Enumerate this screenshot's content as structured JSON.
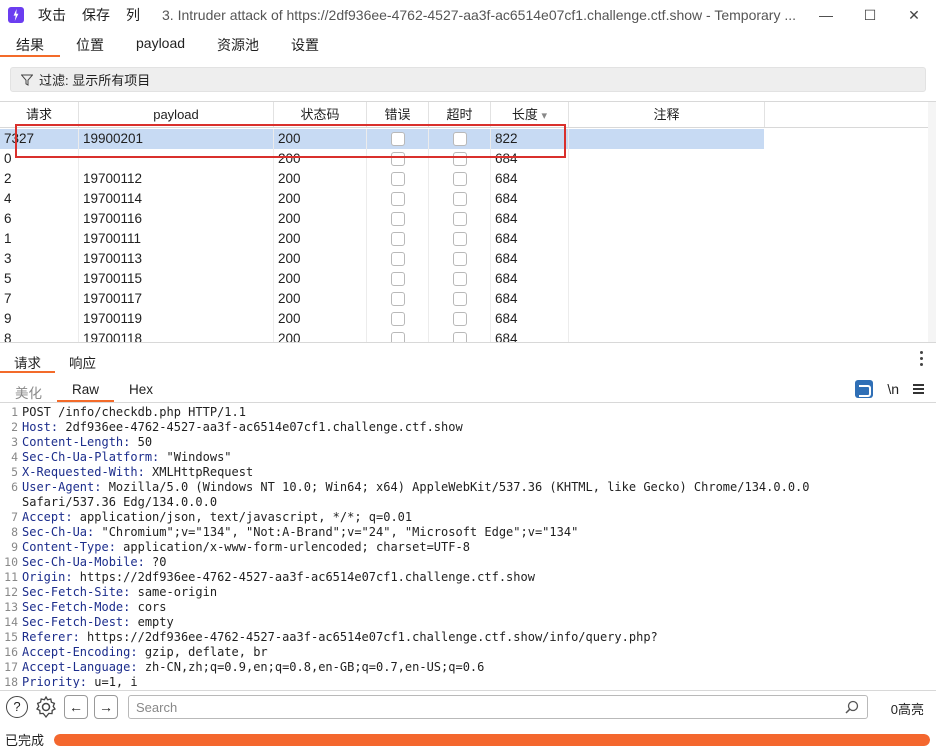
{
  "titlebar": {
    "menu": [
      "攻击",
      "保存",
      "列"
    ],
    "title": "3. Intruder attack of https://2df936ee-4762-4527-aa3f-ac6514e07cf1.challenge.ctf.show - Temporary ..."
  },
  "tabs": [
    "结果",
    "位置",
    "payload",
    "资源池",
    "设置"
  ],
  "filter": {
    "label": "过滤: 显示所有项目"
  },
  "table": {
    "columns": [
      "请求",
      "payload",
      "状态码",
      "错误",
      "超时",
      "长度",
      "注释"
    ],
    "sort_indicator": "▾",
    "rows": [
      {
        "req": "7327",
        "payload": "19900201",
        "status": "200",
        "len": "822"
      },
      {
        "req": "0",
        "payload": "",
        "status": "200",
        "len": "684"
      },
      {
        "req": "2",
        "payload": "19700112",
        "status": "200",
        "len": "684"
      },
      {
        "req": "4",
        "payload": "19700114",
        "status": "200",
        "len": "684"
      },
      {
        "req": "6",
        "payload": "19700116",
        "status": "200",
        "len": "684"
      },
      {
        "req": "1",
        "payload": "19700111",
        "status": "200",
        "len": "684"
      },
      {
        "req": "3",
        "payload": "19700113",
        "status": "200",
        "len": "684"
      },
      {
        "req": "5",
        "payload": "19700115",
        "status": "200",
        "len": "684"
      },
      {
        "req": "7",
        "payload": "19700117",
        "status": "200",
        "len": "684"
      },
      {
        "req": "9",
        "payload": "19700119",
        "status": "200",
        "len": "684"
      },
      {
        "req": "8",
        "payload": "19700118",
        "status": "200",
        "len": "684"
      }
    ]
  },
  "rr_tabs": [
    "请求",
    "响应"
  ],
  "view_tabs": [
    "美化",
    "Raw",
    "Hex"
  ],
  "view_icons": {
    "newline": "\\n"
  },
  "editor": {
    "lines": [
      {
        "n": "1",
        "k": "",
        "v": "POST /info/checkdb.php HTTP/1.1"
      },
      {
        "n": "2",
        "k": "Host:",
        "v": " 2df936ee-4762-4527-aa3f-ac6514e07cf1.challenge.ctf.show"
      },
      {
        "n": "3",
        "k": "Content-Length:",
        "v": " 50"
      },
      {
        "n": "4",
        "k": "Sec-Ch-Ua-Platform:",
        "v": " \"Windows\""
      },
      {
        "n": "5",
        "k": "X-Requested-With:",
        "v": " XMLHttpRequest"
      },
      {
        "n": "6",
        "k": "User-Agent:",
        "v": " Mozilla/5.0 (Windows NT 10.0; Win64; x64) AppleWebKit/537.36 (KHTML, like Gecko) Chrome/134.0.0.0"
      },
      {
        "n": "",
        "k": "",
        "v": "Safari/537.36 Edg/134.0.0.0"
      },
      {
        "n": "7",
        "k": "Accept:",
        "v": " application/json, text/javascript, */*; q=0.01"
      },
      {
        "n": "8",
        "k": "Sec-Ch-Ua:",
        "v": " \"Chromium\";v=\"134\", \"Not:A-Brand\";v=\"24\", \"Microsoft Edge\";v=\"134\""
      },
      {
        "n": "9",
        "k": "Content-Type:",
        "v": " application/x-www-form-urlencoded; charset=UTF-8"
      },
      {
        "n": "10",
        "k": "Sec-Ch-Ua-Mobile:",
        "v": " ?0"
      },
      {
        "n": "11",
        "k": "Origin:",
        "v": " https://2df936ee-4762-4527-aa3f-ac6514e07cf1.challenge.ctf.show"
      },
      {
        "n": "12",
        "k": "Sec-Fetch-Site:",
        "v": " same-origin"
      },
      {
        "n": "13",
        "k": "Sec-Fetch-Mode:",
        "v": " cors"
      },
      {
        "n": "14",
        "k": "Sec-Fetch-Dest:",
        "v": " empty"
      },
      {
        "n": "15",
        "k": "Referer:",
        "v": " https://2df936ee-4762-4527-aa3f-ac6514e07cf1.challenge.ctf.show/info/query.php?"
      },
      {
        "n": "16",
        "k": "Accept-Encoding:",
        "v": " gzip, deflate, br"
      },
      {
        "n": "17",
        "k": "Accept-Language:",
        "v": " zh-CN,zh;q=0.9,en;q=0.8,en-GB;q=0.7,en-US;q=0.6"
      },
      {
        "n": "18",
        "k": "Priority:",
        "v": " u=1, i"
      }
    ]
  },
  "bottom": {
    "search_placeholder": "Search",
    "matches": "0高亮"
  },
  "status": {
    "text": "已完成",
    "progress": 1.0,
    "progress_color": "#f4672e"
  }
}
